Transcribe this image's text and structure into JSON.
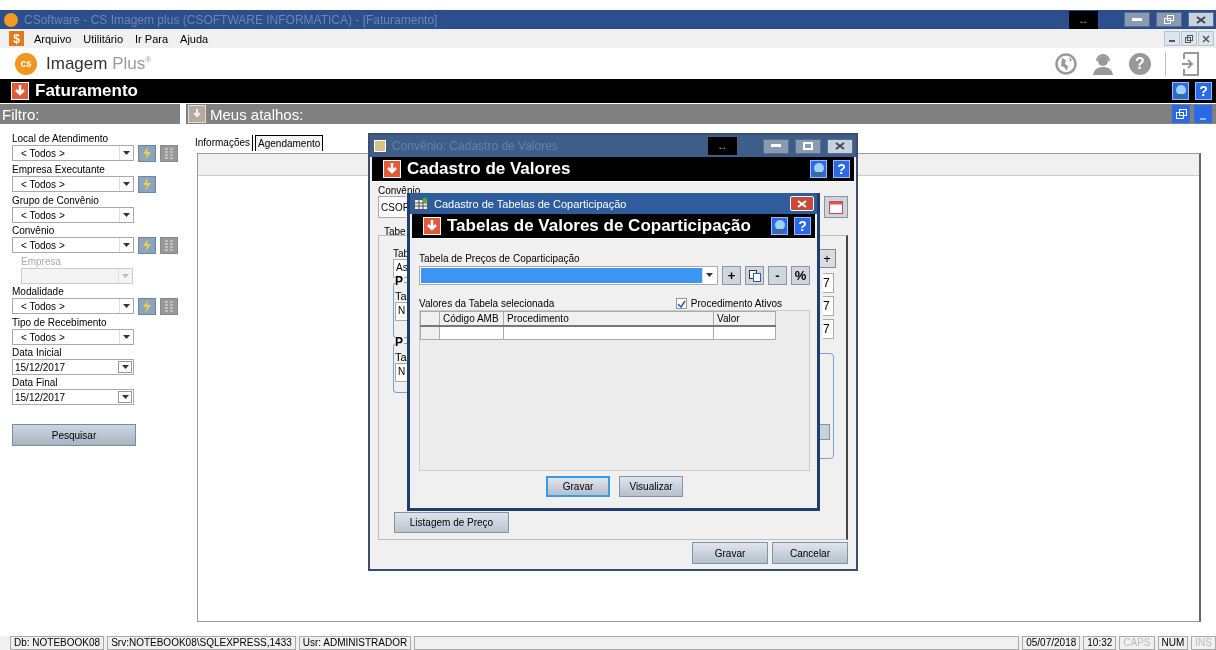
{
  "window": {
    "title": "CSoftware - CS Imagem plus (CSOFTWARE INFORMATICA) - [Faturamento]",
    "resize_glyph": "↔"
  },
  "menu": {
    "icon": "$",
    "items": [
      {
        "label": "Arquivo"
      },
      {
        "label": "Utilitário"
      },
      {
        "label": "Ir Para"
      },
      {
        "label": "Ajuda"
      }
    ]
  },
  "logo": {
    "badge": "cs",
    "name": "Imagem",
    "suffix": "Plus$^{®}$",
    "help": "?"
  },
  "module": {
    "title": "Faturamento",
    "help": "?"
  },
  "filter": {
    "title": "Filtro:",
    "fields": [
      {
        "label": "Local de Atendimento",
        "value": "< Todos >",
        "kind": "combo",
        "disabled": false,
        "run": true,
        "list": true
      },
      {
        "label": "Empresa Executante",
        "value": "< Todos >",
        "kind": "combo",
        "disabled": false,
        "run": true,
        "list": false
      },
      {
        "label": "Grupo de Convênio",
        "value": "< Todos >",
        "kind": "combo",
        "disabled": false,
        "run": false,
        "list": false
      },
      {
        "label": "Convênio",
        "value": "< Todos >",
        "kind": "combo",
        "disabled": false,
        "run": true,
        "list": true
      },
      {
        "label": "Empresa",
        "kind": "combo",
        "disabled": true,
        "run": false,
        "list": false
      },
      {
        "label": "Modalidade",
        "value": "< Todos >",
        "kind": "combo",
        "disabled": false,
        "run": true,
        "list": true
      },
      {
        "label": "Tipo de Recebimento",
        "value": "< Todos >",
        "kind": "combo",
        "disabled": false,
        "run": false,
        "list": false
      },
      {
        "label": "Data Inicial",
        "value": "15/12/2017",
        "kind": "date",
        "disabled": false,
        "run": false,
        "list": false
      },
      {
        "label": "Data Final",
        "value": "15/12/2017",
        "kind": "date",
        "disabled": false,
        "run": false,
        "list": false
      }
    ],
    "search_button": "Pesquisar"
  },
  "shortcuts": {
    "title": "Meus atalhos:",
    "tabs": [
      {
        "label": "Informações",
        "selected": true
      },
      {
        "label": "Agendamento",
        "selected": false
      }
    ]
  },
  "dialog_values": {
    "title": "Convênio: Cadastro de Valores",
    "resize_glyph": "↔",
    "header": "Cadastro de Valores",
    "help": "?",
    "convenio_label": "Convênio",
    "convenio_value": "CSOF",
    "tab": "Tabe",
    "table_label": "Tab",
    "table_value": "As",
    "add": "+",
    "groups": [
      {
        "legend": "P",
        "label": "Ta",
        "value": "N"
      },
      {
        "legend": "P",
        "label": "Ta",
        "value": "N"
      }
    ],
    "right_fields": [
      "7",
      "7",
      "7"
    ],
    "list_button": "Listagem de Preço",
    "buttons": [
      "Gravar",
      "Cancelar"
    ]
  },
  "dialog_copart": {
    "title": "Cadastro de Tabelas de Coparticipação",
    "header": "Tabelas de Valores de Coparticipação",
    "help": "?",
    "price_label": "Tabela de Preços  de Coparticipação",
    "tools": [
      {
        "kind": "text",
        "label": "+"
      },
      {
        "kind": "copy"
      },
      {
        "kind": "text",
        "label": "-"
      },
      {
        "kind": "text",
        "label": "%"
      }
    ],
    "grid_label": "Valores da Tabela selecionada",
    "active": {
      "label": "Procedimento Ativos",
      "checked": true
    },
    "columns": [
      "Código AMB",
      "Procedimento",
      "Valor"
    ],
    "buttons": [
      {
        "label": "Gravar",
        "focused": true
      },
      {
        "label": "Visualizar",
        "focused": false
      }
    ]
  },
  "status_bar": {
    "left": [
      "Db: NOTEBOOK08",
      "Srv:NOTEBOOK08\\SQLEXPRESS,1433",
      "Usr: ADMINISTRADOR"
    ],
    "right": [
      {
        "text": "05/07/2018",
        "enabled": true
      },
      {
        "text": "10:32",
        "enabled": true
      },
      {
        "text": "CAPS",
        "enabled": false
      },
      {
        "text": "NUM",
        "enabled": true
      },
      {
        "text": "INS",
        "enabled": false
      }
    ]
  }
}
